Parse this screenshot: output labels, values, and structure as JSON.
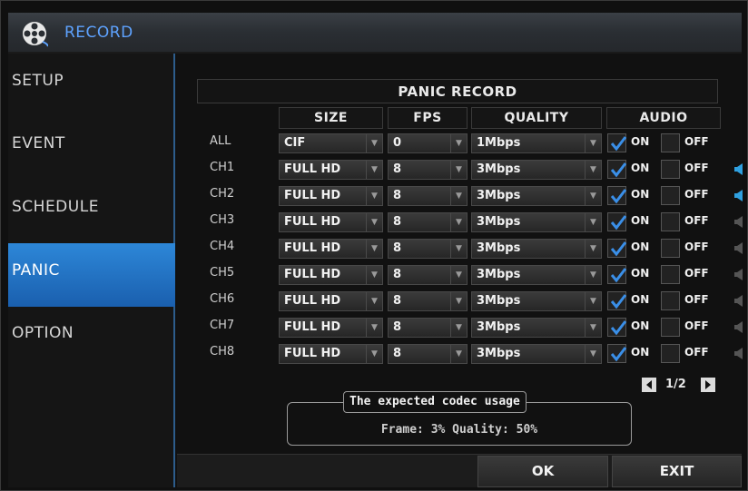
{
  "window": {
    "title": "RECORD",
    "icon": "film-reel-icon"
  },
  "sidebar": {
    "items": [
      {
        "label": "SETUP"
      },
      {
        "label": "EVENT"
      },
      {
        "label": "SCHEDULE"
      },
      {
        "label": "PANIC",
        "active": true
      },
      {
        "label": "OPTION"
      }
    ]
  },
  "panic": {
    "title": "PANIC RECORD",
    "columns": {
      "size": "SIZE",
      "fps": "FPS",
      "quality": "QUALITY",
      "audio": "AUDIO"
    },
    "rows": [
      {
        "ch": "ALL",
        "size": "CIF",
        "fps": "0",
        "quality": "1Mbps",
        "on": true,
        "off": false,
        "on_label": "ON",
        "off_label": "OFF",
        "speaker": null
      },
      {
        "ch": "CH1",
        "size": "FULL HD",
        "fps": "8",
        "quality": "3Mbps",
        "on": true,
        "off": false,
        "on_label": "ON",
        "off_label": "OFF",
        "speaker": "active"
      },
      {
        "ch": "CH2",
        "size": "FULL HD",
        "fps": "8",
        "quality": "3Mbps",
        "on": true,
        "off": false,
        "on_label": "ON",
        "off_label": "OFF",
        "speaker": "active"
      },
      {
        "ch": "CH3",
        "size": "FULL HD",
        "fps": "8",
        "quality": "3Mbps",
        "on": true,
        "off": false,
        "on_label": "ON",
        "off_label": "OFF",
        "speaker": "inactive"
      },
      {
        "ch": "CH4",
        "size": "FULL HD",
        "fps": "8",
        "quality": "3Mbps",
        "on": true,
        "off": false,
        "on_label": "ON",
        "off_label": "OFF",
        "speaker": "inactive"
      },
      {
        "ch": "CH5",
        "size": "FULL HD",
        "fps": "8",
        "quality": "3Mbps",
        "on": true,
        "off": false,
        "on_label": "ON",
        "off_label": "OFF",
        "speaker": "inactive"
      },
      {
        "ch": "CH6",
        "size": "FULL HD",
        "fps": "8",
        "quality": "3Mbps",
        "on": true,
        "off": false,
        "on_label": "ON",
        "off_label": "OFF",
        "speaker": "inactive"
      },
      {
        "ch": "CH7",
        "size": "FULL HD",
        "fps": "8",
        "quality": "3Mbps",
        "on": true,
        "off": false,
        "on_label": "ON",
        "off_label": "OFF",
        "speaker": "inactive"
      },
      {
        "ch": "CH8",
        "size": "FULL HD",
        "fps": "8",
        "quality": "3Mbps",
        "on": true,
        "off": false,
        "on_label": "ON",
        "off_label": "OFF",
        "speaker": "inactive"
      }
    ],
    "pager": {
      "text": "1/2"
    },
    "codec": {
      "title": "The expected codec usage",
      "line": "Frame: 3%  Quality: 50%"
    }
  },
  "buttons": {
    "ok": "OK",
    "exit": "EXIT"
  },
  "colors": {
    "accent": "#2d87d8",
    "title_text": "#5ea3ff",
    "check": "#3a8fe8",
    "speaker_active": "#2fa0e0",
    "speaker_inactive": "#555555"
  }
}
